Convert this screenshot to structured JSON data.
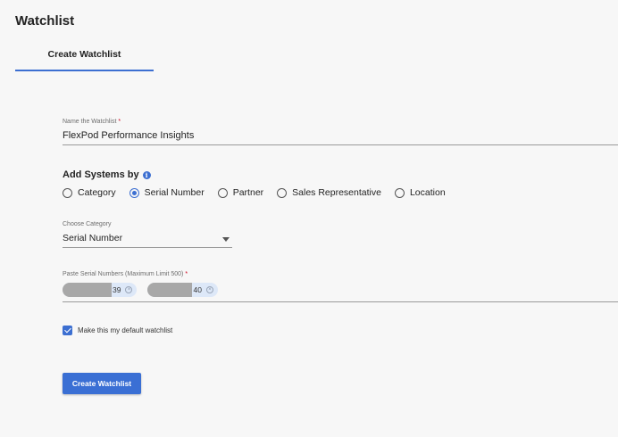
{
  "header": {
    "title": "Watchlist"
  },
  "tabs": [
    {
      "label": "Create Watchlist",
      "active": true
    }
  ],
  "form": {
    "name": {
      "label": "Name the Watchlist",
      "required_mark": "*",
      "value": "FlexPod Performance Insights"
    },
    "add_systems": {
      "title": "Add Systems by",
      "info_icon": "info-icon",
      "options": [
        {
          "label": "Category",
          "selected": false
        },
        {
          "label": "Serial Number",
          "selected": true
        },
        {
          "label": "Partner",
          "selected": false
        },
        {
          "label": "Sales Representative",
          "selected": false
        },
        {
          "label": "Location",
          "selected": false
        }
      ]
    },
    "category": {
      "label": "Choose Category",
      "value": "Serial Number"
    },
    "serials": {
      "label": "Paste Serial Numbers (Maximum Limit 500)",
      "required_mark": "*",
      "chips": [
        {
          "visible_suffix": "39"
        },
        {
          "visible_suffix": "40"
        }
      ]
    },
    "default_checkbox": {
      "label": "Make this my default watchlist",
      "checked": true
    },
    "submit_label": "Create Watchlist"
  },
  "colors": {
    "accent": "#3c6fd1",
    "background": "#f7f7f7",
    "chip": "#dde8f8",
    "required": "#d0021b"
  }
}
